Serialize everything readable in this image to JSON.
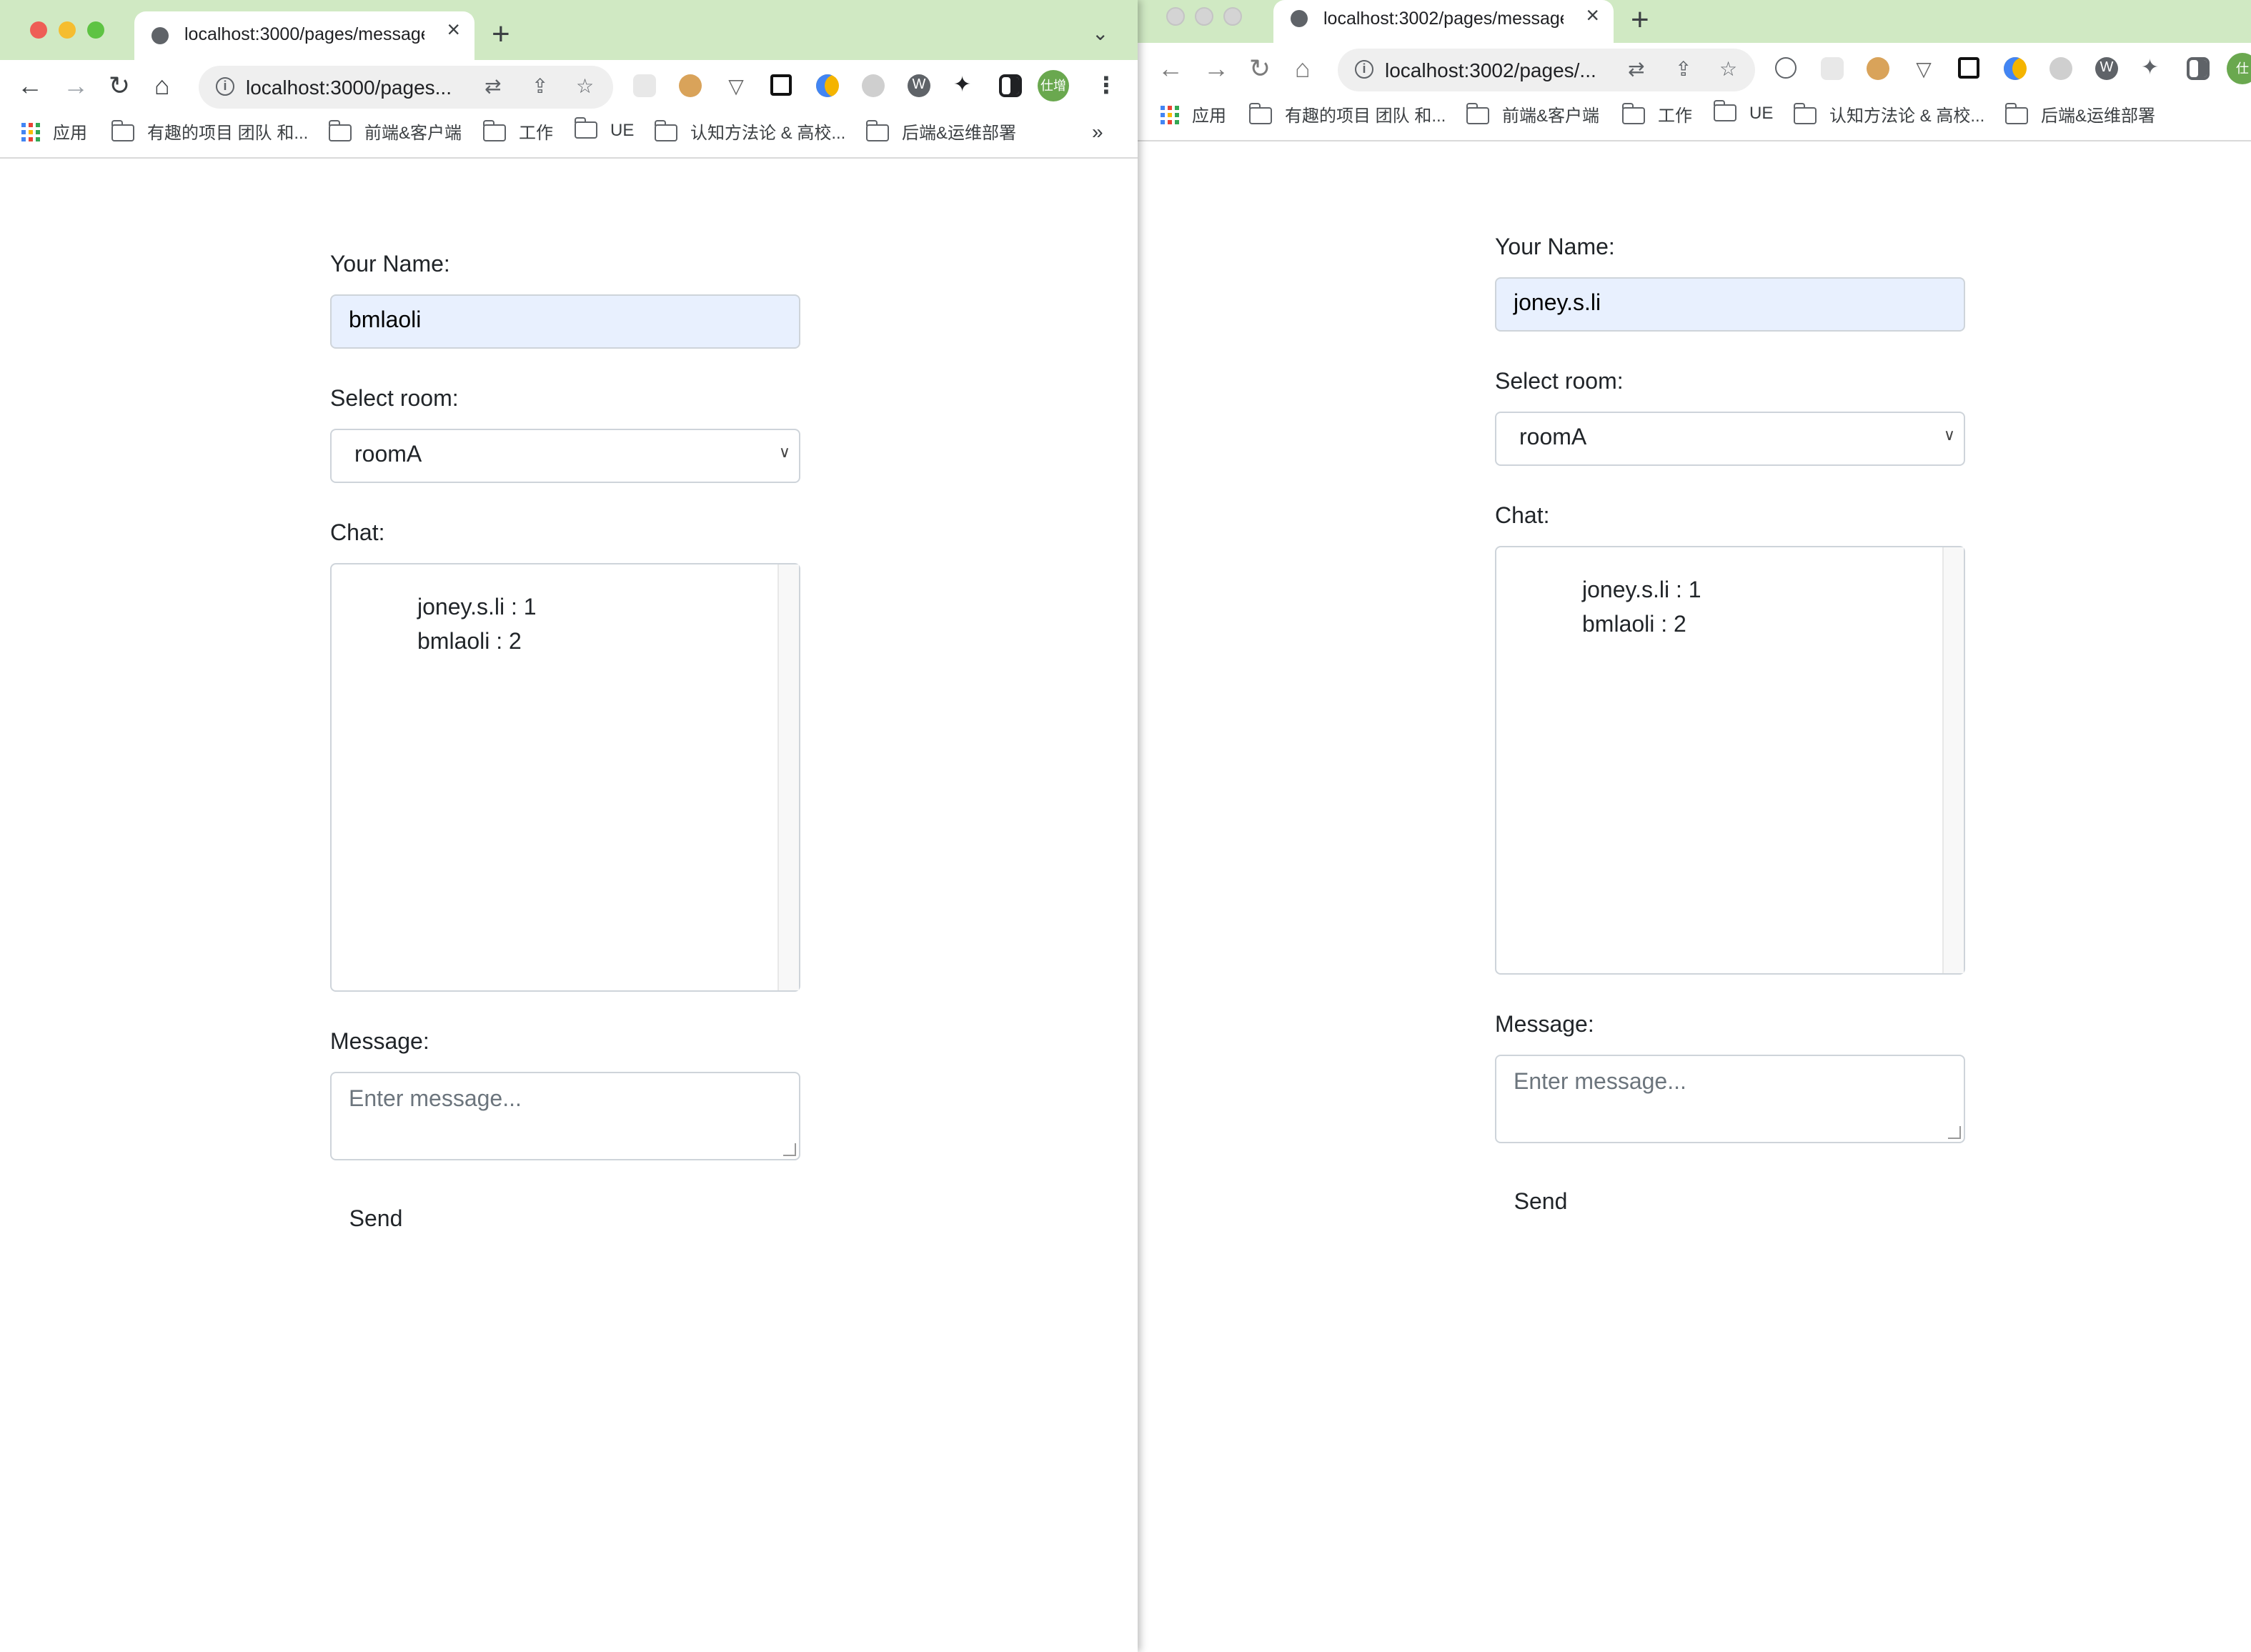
{
  "windows": [
    {
      "tab_title": "localhost:3000/pages/message",
      "url": "localhost:3000/pages...",
      "profile": "仕增",
      "bookmarks": [
        "应用",
        "有趣的项目 团队 和...",
        "前端&客户端",
        "工作",
        "UE",
        "认知方法论 & 高校...",
        "后端&运维部署"
      ],
      "form": {
        "name_label": "Your Name:",
        "name_value": "bmlaoli",
        "room_label": "Select room:",
        "room_value": "roomA",
        "chat_label": "Chat:",
        "chat_lines": [
          "joney.s.li : 1",
          "bmlaoli : 2"
        ],
        "message_label": "Message:",
        "message_placeholder": "Enter message...",
        "send_label": "Send"
      }
    },
    {
      "tab_title": "localhost:3002/pages/message",
      "url": "localhost:3002/pages/...",
      "profile": "仕",
      "bookmarks": [
        "应用",
        "有趣的项目 团队 和...",
        "前端&客户端",
        "工作",
        "UE",
        "认知方法论 & 高校...",
        "后端&运维部署"
      ],
      "form": {
        "name_label": "Your Name:",
        "name_value": "joney.s.li",
        "room_label": "Select room:",
        "room_value": "roomA",
        "chat_label": "Chat:",
        "chat_lines": [
          "joney.s.li : 1",
          "bmlaoli : 2"
        ],
        "message_label": "Message:",
        "message_placeholder": "Enter message...",
        "send_label": "Send"
      }
    }
  ],
  "more_bookmarks_glyph": "»",
  "colors": {
    "tabstrip": "#d0e9c3",
    "name_input_bg": "#e8f0fe",
    "profile": "#6aa84f"
  }
}
